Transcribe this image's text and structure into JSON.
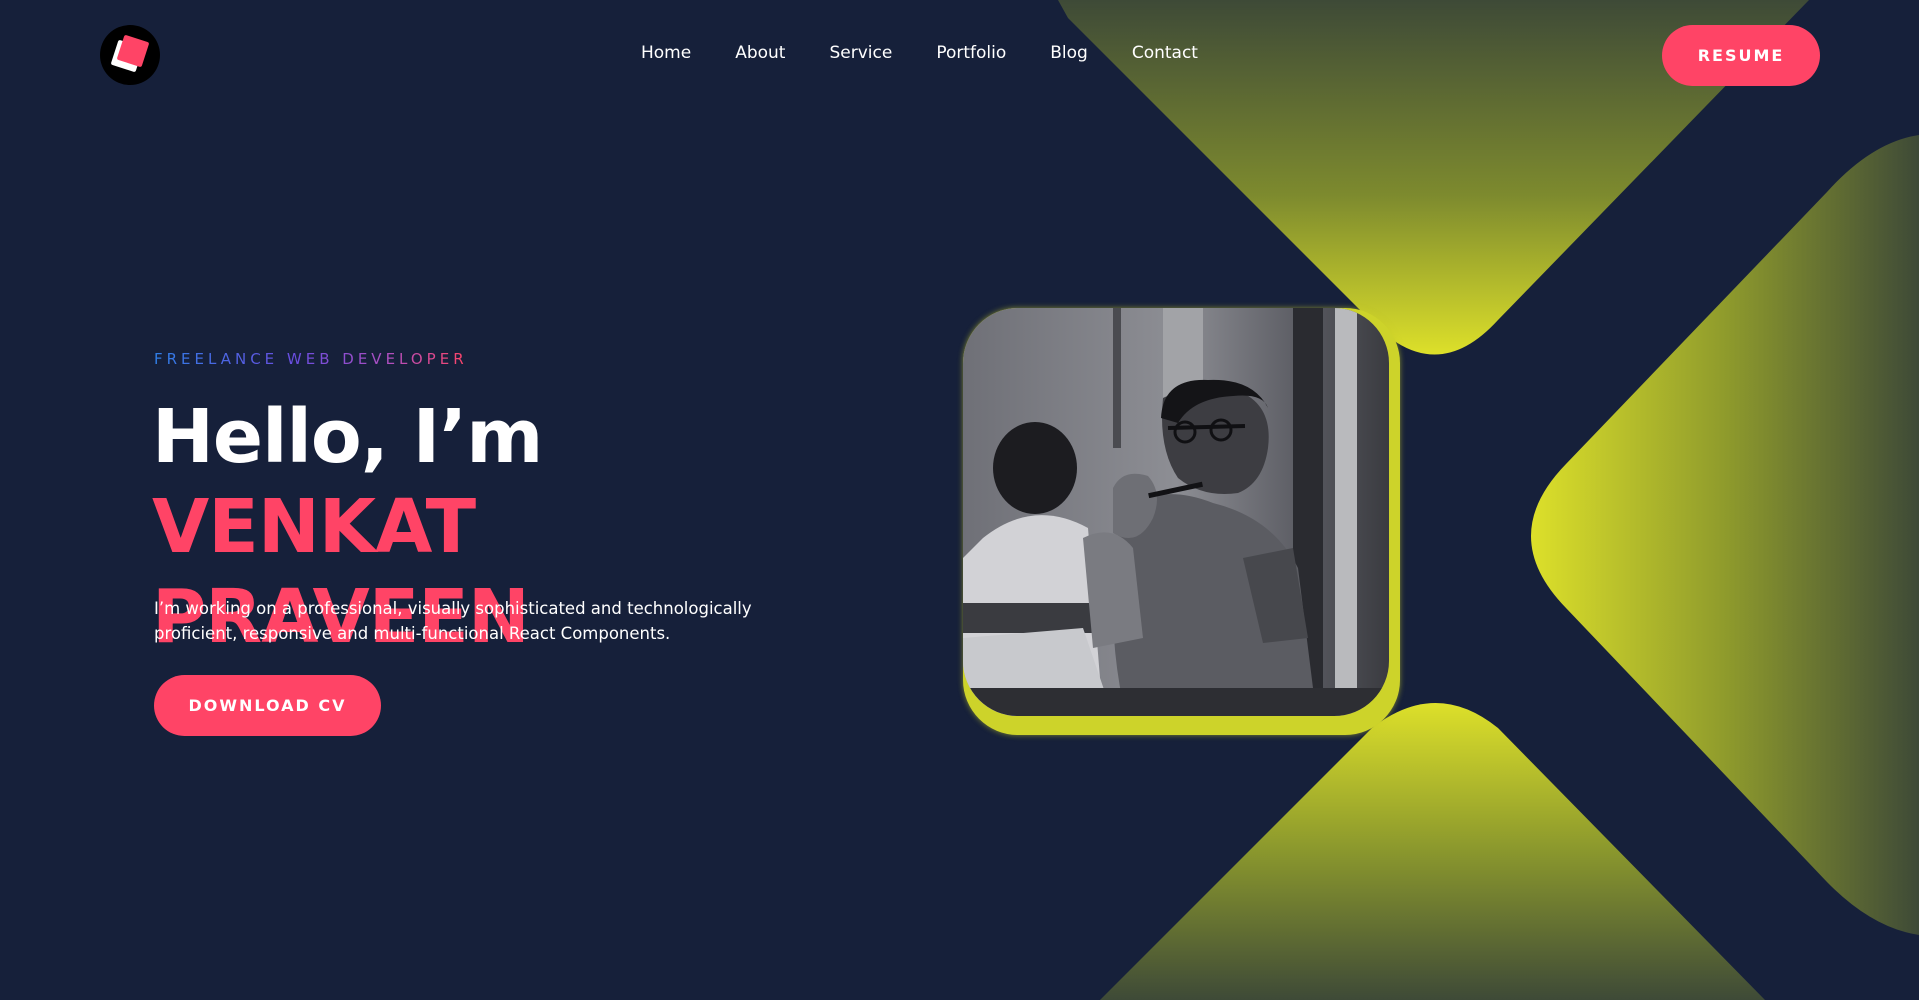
{
  "header": {
    "nav": [
      "Home",
      "About",
      "Service",
      "Portfolio",
      "Blog",
      "Contact"
    ],
    "resume_label": "RESUME"
  },
  "hero": {
    "eyebrow": "FREELANCE WEB DEVELOPER",
    "greeting": "Hello, I’m ",
    "first_name": "VENKAT",
    "last_name": "PRAVEEN",
    "description": "I’m working on a professional, visually sophisticated and technologically proficient, responsive and multi-functional React Components.",
    "download_label": "DOWNLOAD CV"
  },
  "colors": {
    "background": "#16203a",
    "accent": "#ff4466",
    "lime": "#d9e02a",
    "olive": "#3f4a37"
  },
  "icons": {
    "logo": "brand-logo-squares"
  }
}
